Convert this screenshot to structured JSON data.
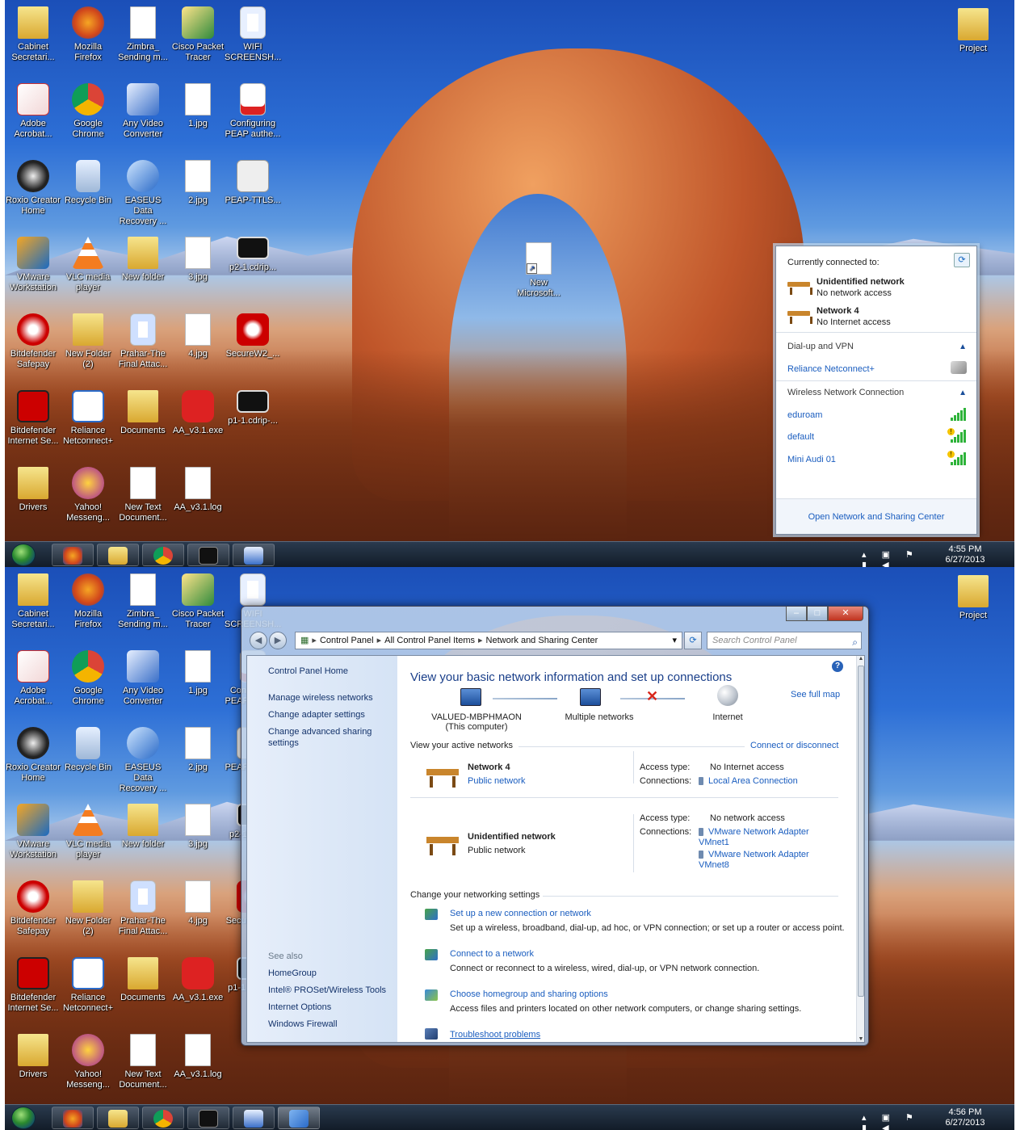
{
  "desktop": {
    "icons_col1": [
      {
        "label": "Cabinet Secretari...",
        "kind": "folder"
      },
      {
        "label": "Adobe Acrobat...",
        "kind": "acrobat"
      },
      {
        "label": "Roxio Creator Home",
        "kind": "roxio"
      },
      {
        "label": "VMware Workstation",
        "kind": "vmware"
      },
      {
        "label": "Bitdefender Safepay",
        "kind": "bitdefender"
      },
      {
        "label": "Bitdefender Internet Se...",
        "kind": "bitdefenderB"
      },
      {
        "label": "Drivers",
        "kind": "folder"
      }
    ],
    "icons_col2": [
      {
        "label": "Mozilla Firefox",
        "kind": "firefox"
      },
      {
        "label": "Google Chrome",
        "kind": "chrome"
      },
      {
        "label": "Recycle Bin",
        "kind": "recycle"
      },
      {
        "label": "VLC media player",
        "kind": "vlc"
      },
      {
        "label": "New Folder (2)",
        "kind": "folder"
      },
      {
        "label": "Reliance Netconnect+",
        "kind": "reliance"
      },
      {
        "label": "Yahoo! Messeng...",
        "kind": "yahoo"
      }
    ],
    "icons_col3": [
      {
        "label": "Zimbra_ Sending m...",
        "kind": "doc"
      },
      {
        "label": "Any Video Converter",
        "kind": "avc"
      },
      {
        "label": "EASEUS Data Recovery ...",
        "kind": "easeus"
      },
      {
        "label": "New folder",
        "kind": "folder"
      },
      {
        "label": "Prahar-The Final Attac...",
        "kind": "media"
      },
      {
        "label": "Documents",
        "kind": "folder"
      },
      {
        "label": "New Text Document...",
        "kind": "doc"
      }
    ],
    "icons_col4": [
      {
        "label": "Cisco Packet Tracer",
        "kind": "cisco"
      },
      {
        "label": "1.jpg",
        "kind": "doc"
      },
      {
        "label": "2.jpg",
        "kind": "doc"
      },
      {
        "label": "3.jpg",
        "kind": "doc"
      },
      {
        "label": "4.jpg",
        "kind": "doc"
      },
      {
        "label": "AA_v3.1.exe",
        "kind": "aa"
      },
      {
        "label": "AA_v3.1.log",
        "kind": "doc"
      }
    ],
    "icons_col5": [
      {
        "label": "WIFI SCREENSH...",
        "kind": "word"
      },
      {
        "label": "Configuring PEAP authe...",
        "kind": "pdf"
      },
      {
        "label": "PEAP-TTLS...",
        "kind": "peap"
      },
      {
        "label": "p2-1.cdrip...",
        "kind": "video"
      },
      {
        "label": "SecureW2_...",
        "kind": "securew2"
      },
      {
        "label": "p1-1.cdrip-...",
        "kind": "video"
      }
    ],
    "extra_icons": [
      {
        "label": "New Microsoft...",
        "kind": "word"
      },
      {
        "label": "Project",
        "kind": "folder"
      }
    ]
  },
  "flyout": {
    "currently_connected": "Currently connected to:",
    "networks": [
      {
        "name": "Unidentified network",
        "status": "No network access"
      },
      {
        "name": "Network  4",
        "status": "No Internet access"
      }
    ],
    "dialup_header": "Dial-up and VPN",
    "dialup_items": [
      "Reliance Netconnect+"
    ],
    "wireless_header": "Wireless Network Connection",
    "wireless_items": [
      "eduroam",
      "default",
      "Mini Audi 01"
    ],
    "footer_link": "Open Network and Sharing Center"
  },
  "taskbar1": {
    "time": "4:55 PM",
    "date": "6/27/2013"
  },
  "taskbar2": {
    "time": "4:56 PM",
    "date": "6/27/2013"
  },
  "window": {
    "breadcrumb": [
      "Control Panel",
      "All Control Panel Items",
      "Network and Sharing Center"
    ],
    "search_placeholder": "Search Control Panel",
    "left_nav": {
      "home": "Control Panel Home",
      "links": [
        "Manage wireless networks",
        "Change adapter settings",
        "Change advanced sharing settings"
      ],
      "see_also_title": "See also",
      "see_also": [
        "HomeGroup",
        "Intel® PROSet/Wireless Tools",
        "Internet Options",
        "Windows Firewall"
      ]
    },
    "main": {
      "title": "View your basic network information and set up connections",
      "see_full_map": "See full map",
      "computer_name": "VALUED-MBPHMAON",
      "computer_sub": "(This computer)",
      "multiple_networks": "Multiple networks",
      "internet": "Internet",
      "active_header": "View your active networks",
      "connect_disconnect": "Connect or disconnect",
      "active": [
        {
          "name": "Network  4",
          "type": "Public network",
          "access_label": "Access type:",
          "access_value": "No Internet access",
          "conn_label": "Connections:",
          "connections": [
            "Local Area Connection"
          ]
        },
        {
          "name": "Unidentified network",
          "type": "Public network",
          "access_label": "Access type:",
          "access_value": "No network access",
          "conn_label": "Connections:",
          "connections": [
            "VMware Network Adapter VMnet1",
            "VMware Network Adapter VMnet8"
          ]
        }
      ],
      "change_header": "Change your networking settings",
      "tasks": [
        {
          "link": "Set up a new connection or network",
          "desc": "Set up a wireless, broadband, dial-up, ad hoc, or VPN connection; or set up a router or access point."
        },
        {
          "link": "Connect to a network",
          "desc": "Connect or reconnect to a wireless, wired, dial-up, or VPN network connection."
        },
        {
          "link": "Choose homegroup and sharing options",
          "desc": "Access files and printers located on other network computers, or change sharing settings."
        },
        {
          "link": "Troubleshoot problems",
          "desc": ""
        }
      ]
    }
  },
  "colors": {
    "link": "#1a5dbf",
    "title": "#1a3f8a",
    "signal": "#2eb33a"
  }
}
